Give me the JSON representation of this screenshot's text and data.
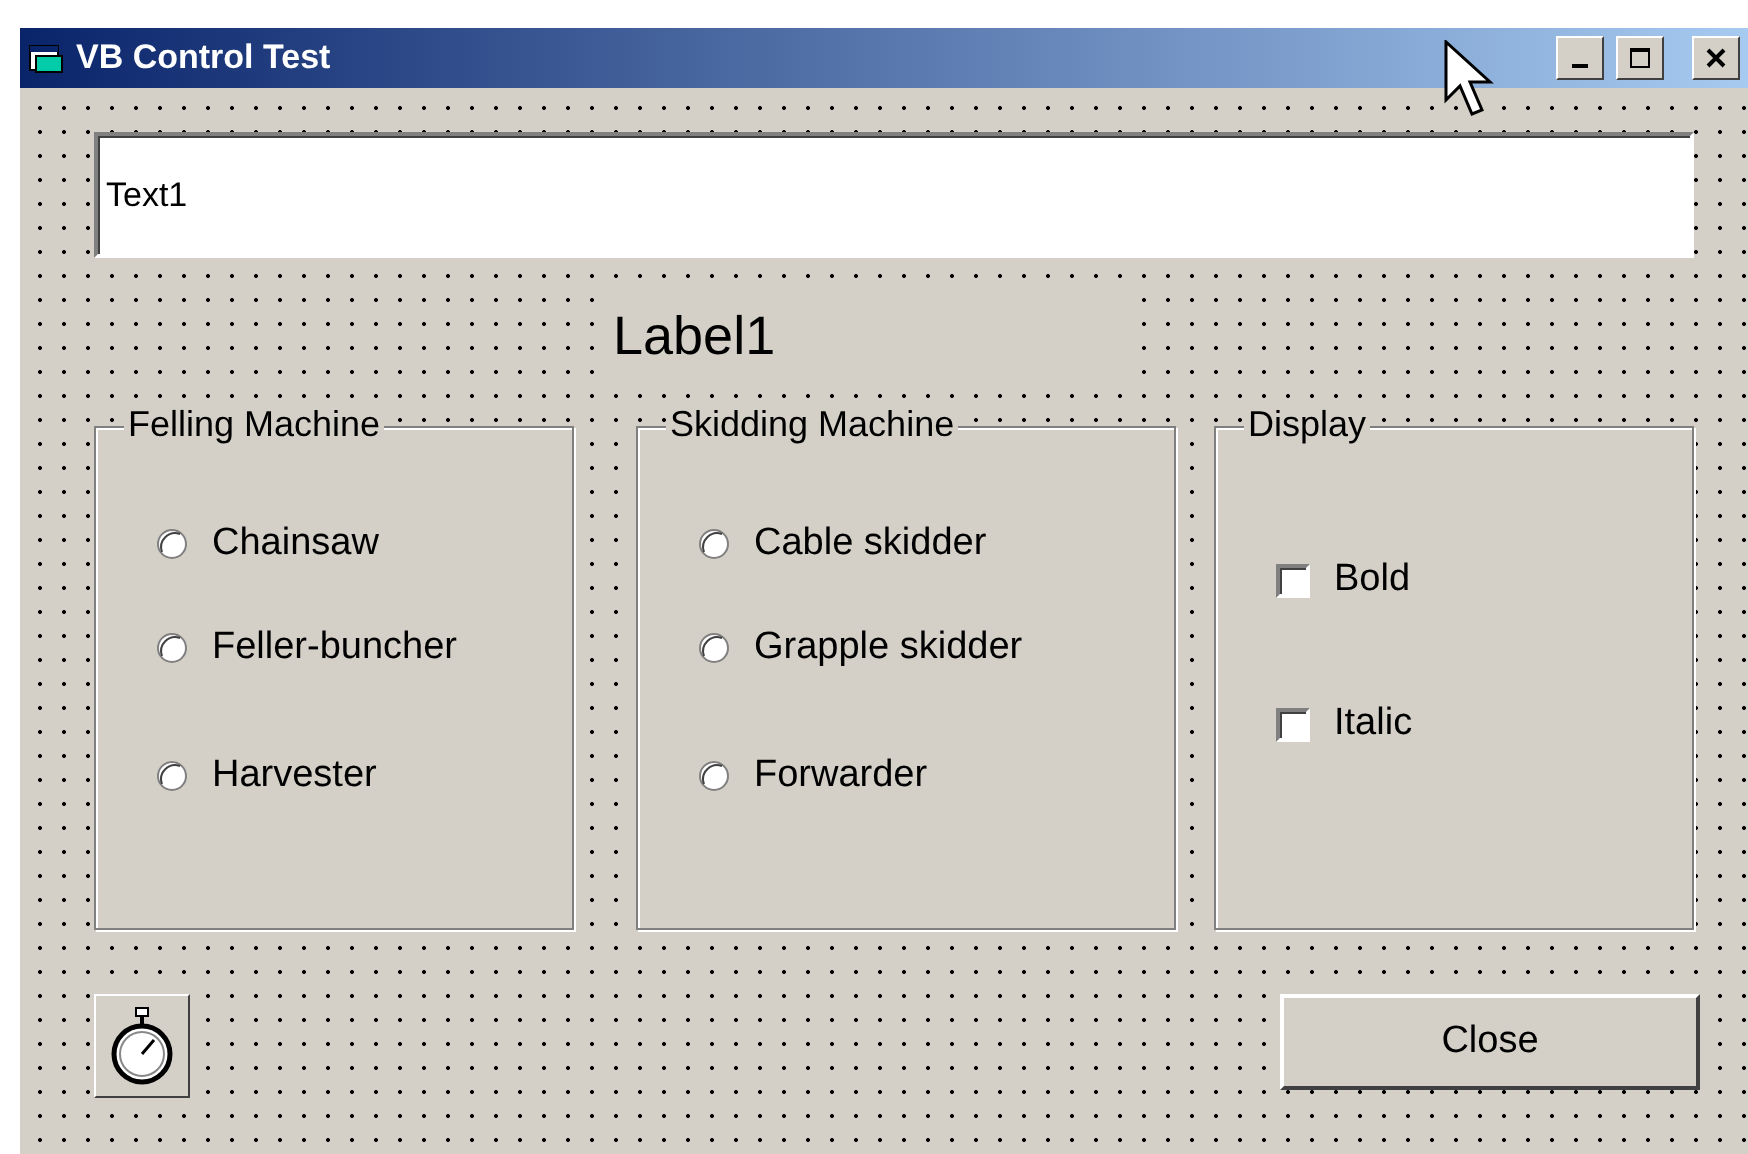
{
  "window": {
    "title": "VB Control Test"
  },
  "text_box": {
    "value": "Text1"
  },
  "label": {
    "text": "Label1"
  },
  "frames": [
    {
      "title": "Felling Machine",
      "kind": "radio",
      "options": [
        {
          "label": "Chainsaw",
          "selected": false
        },
        {
          "label": "Feller-buncher",
          "selected": false
        },
        {
          "label": "Harvester",
          "selected": false
        }
      ]
    },
    {
      "title": "Skidding Machine",
      "kind": "radio",
      "options": [
        {
          "label": "Cable skidder",
          "selected": false
        },
        {
          "label": "Grapple skidder",
          "selected": false
        },
        {
          "label": "Forwarder",
          "selected": false
        }
      ]
    },
    {
      "title": "Display",
      "kind": "checkbox",
      "options": [
        {
          "label": "Bold",
          "checked": false
        },
        {
          "label": "Italic",
          "checked": false
        }
      ]
    }
  ],
  "buttons": [
    "Close"
  ]
}
